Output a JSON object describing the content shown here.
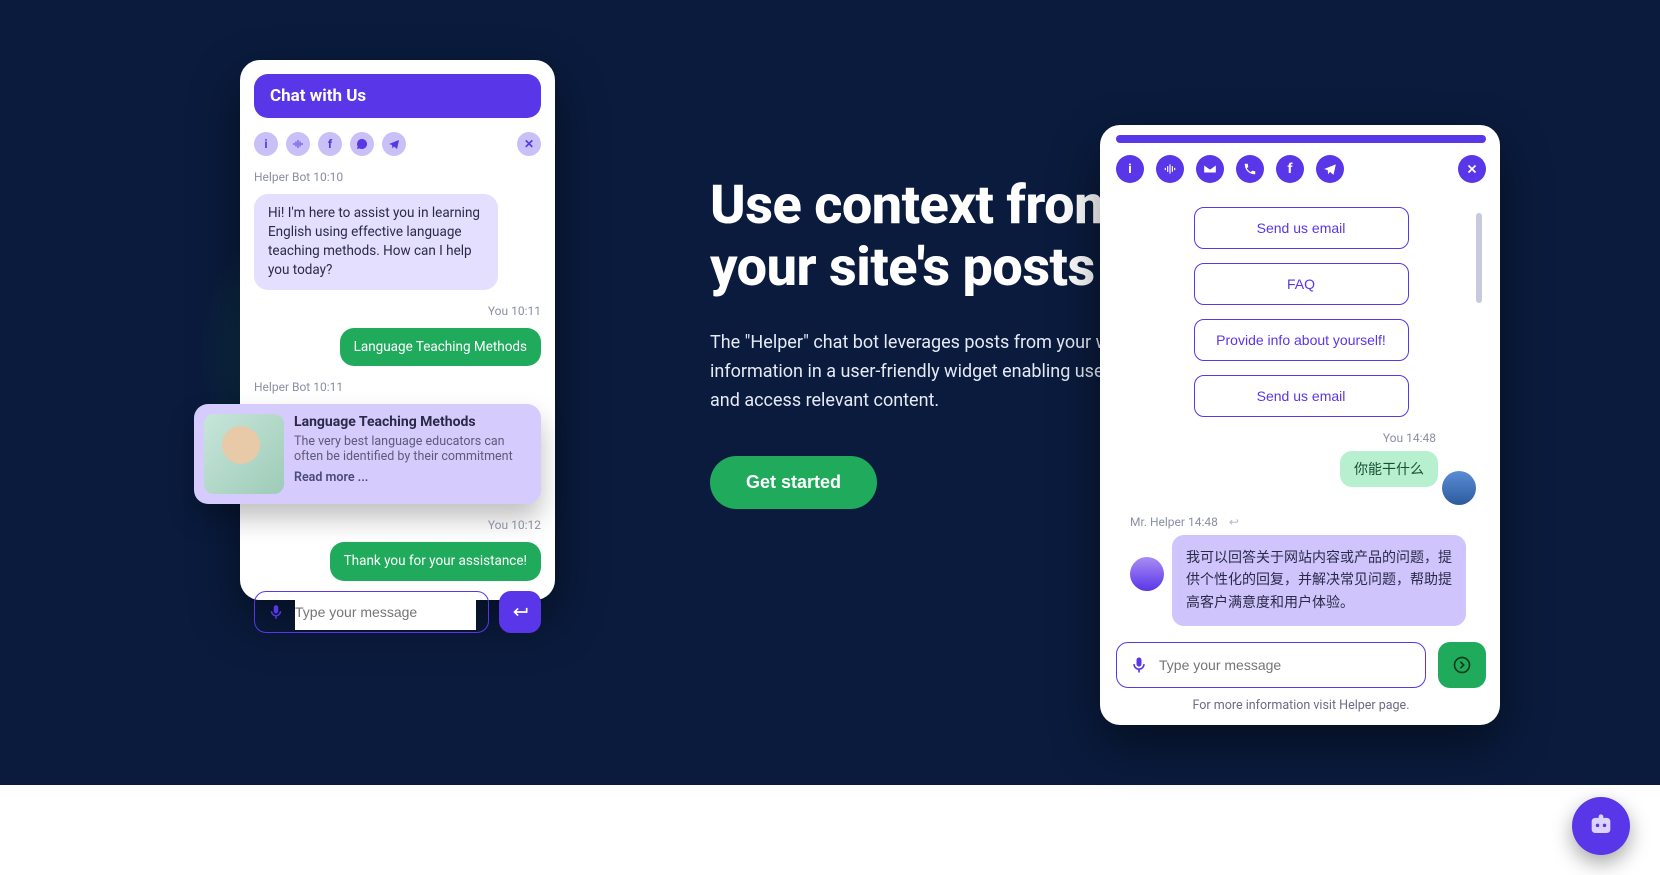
{
  "hero": {
    "headline_line1": "Use context from",
    "headline_line2": "your site's posts",
    "subcopy": "The \"Helper\" chat bot leverages posts from your website, presents the information in a user-friendly widget enabling users to conveniently read and access relevant content.",
    "cta": "Get started"
  },
  "chat": {
    "header": "Chat with Us",
    "input_placeholder": "Type your message",
    "thread": {
      "bot1_meta": "Helper Bot 10:10",
      "bot1_text": "Hi! I'm here to assist you in learning English using effective language teaching methods. How can I help you today?",
      "user1_meta": "You 10:11",
      "user1_text": "Language Teaching Methods",
      "bot2_meta": "Helper Bot 10:11",
      "card": {
        "title": "Language Teaching Methods",
        "sub": "The very best language educators can often be identified by their commitment",
        "link": "Read more ..."
      },
      "user2_meta": "You 10:12",
      "user2_text": "Thank you for your assistance!"
    }
  },
  "helper": {
    "options": [
      "Send us email",
      "FAQ",
      "Provide info about yourself!",
      "Send us email"
    ],
    "user_meta": "You 14:48",
    "user_text": "你能干什么",
    "bot_meta_name": "Mr. Helper",
    "bot_meta_time": "14:48",
    "bot_text": "我可以回答关于网站内容或产品的问题，提供个性化的回复，并解决常见问题，帮助提高客户满意度和用户体验。",
    "input_placeholder": "Type your message",
    "footer": "For more information visit Helper page."
  }
}
